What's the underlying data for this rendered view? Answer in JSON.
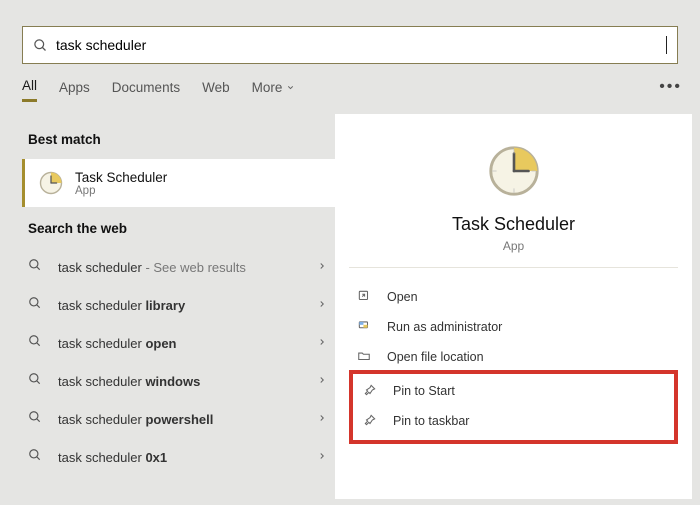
{
  "search": {
    "value": "task scheduler"
  },
  "tabs": {
    "items": [
      "All",
      "Apps",
      "Documents",
      "Web",
      "More"
    ],
    "active": 0
  },
  "left": {
    "best_match_label": "Best match",
    "best": {
      "title": "Task Scheduler",
      "subtitle": "App"
    },
    "web_label": "Search the web",
    "web_items": [
      {
        "prefix": "task scheduler",
        "bold": "",
        "suffix": " - See web results",
        "suffix_muted": true
      },
      {
        "prefix": "task scheduler ",
        "bold": "library",
        "suffix": ""
      },
      {
        "prefix": "task scheduler ",
        "bold": "open",
        "suffix": ""
      },
      {
        "prefix": "task scheduler ",
        "bold": "windows",
        "suffix": ""
      },
      {
        "prefix": "task scheduler ",
        "bold": "powershell",
        "suffix": ""
      },
      {
        "prefix": "task scheduler ",
        "bold": "0x1",
        "suffix": ""
      }
    ]
  },
  "right": {
    "title": "Task Scheduler",
    "subtitle": "App",
    "actions": [
      {
        "id": "open",
        "label": "Open",
        "icon": "open-icon"
      },
      {
        "id": "runas",
        "label": "Run as administrator",
        "icon": "shield-icon"
      },
      {
        "id": "loc",
        "label": "Open file location",
        "icon": "folder-icon"
      },
      {
        "id": "pinstart",
        "label": "Pin to Start",
        "icon": "pin-icon"
      },
      {
        "id": "pintask",
        "label": "Pin to taskbar",
        "icon": "pin-icon"
      }
    ]
  }
}
